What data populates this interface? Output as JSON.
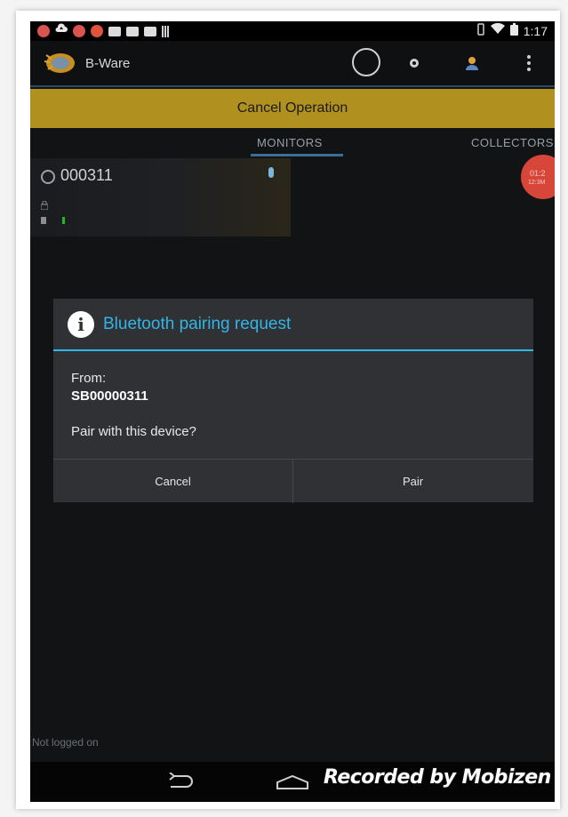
{
  "status_bar": {
    "notification_icons": [
      "app-icon",
      "upload-icon",
      "app-icon",
      "app-icon",
      "mail-icon",
      "mail-icon",
      "clipboard-check-icon",
      "bars-icon"
    ],
    "time": "1:17",
    "system_icons": [
      "vibrate-icon",
      "wifi-icon",
      "battery-icon"
    ]
  },
  "action_bar": {
    "app_title": "B-Ware",
    "icons": [
      "spinner-icon",
      "settings-icon",
      "user-icon",
      "overflow-menu-icon"
    ]
  },
  "cancel_operation_label": "Cancel Operation",
  "tabs": [
    {
      "label": "MONITORS",
      "selected": true
    },
    {
      "label": "COLLECTORS",
      "selected": false
    }
  ],
  "monitor_card": {
    "id": "000311"
  },
  "badge": {
    "line1": "01:2",
    "line2": "12:3M"
  },
  "dialog": {
    "title": "Bluetooth pairing request",
    "from_label": "From:",
    "from_value": "SB00000311",
    "question": "Pair with this device?",
    "cancel_label": "Cancel",
    "pair_label": "Pair"
  },
  "footer_status": "Not logged on",
  "watermark": "Recorded by Mobizen",
  "colors": {
    "accent_blue": "#33b5e5",
    "cancel_bar": "#b0901e",
    "badge_red": "#d8463a",
    "screen_bg": "#121315"
  }
}
